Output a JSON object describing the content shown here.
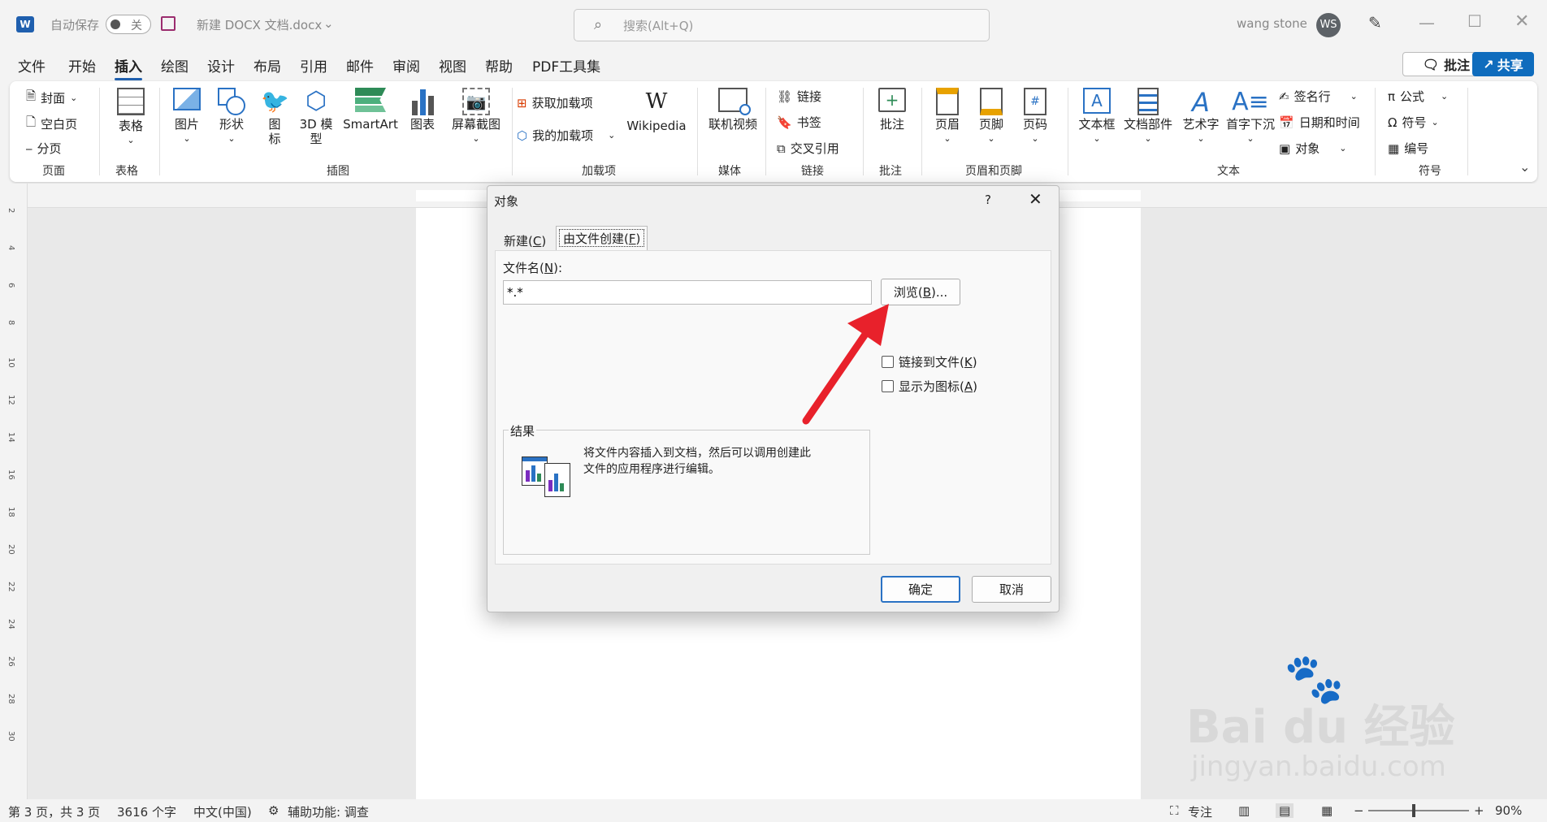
{
  "titlebar": {
    "autosave_label": "自动保存",
    "autosave_state": "关",
    "doc_title": "新建 DOCX 文档.docx",
    "search_placeholder": "搜索(Alt+Q)",
    "user_name": "wang stone",
    "user_initials": "WS"
  },
  "menu_tabs": [
    "文件",
    "开始",
    "插入",
    "绘图",
    "设计",
    "布局",
    "引用",
    "邮件",
    "审阅",
    "视图",
    "帮助",
    "PDF工具集"
  ],
  "active_tab": "插入",
  "top_right": {
    "comment": "批注",
    "share": "共享"
  },
  "ribbon": {
    "pages": {
      "cover": "封面",
      "blank": "空白页",
      "break": "分页",
      "label": "页面"
    },
    "table": {
      "btn": "表格",
      "label": "表格"
    },
    "illustrations": {
      "picture": "图片",
      "shape": "形状",
      "icon1": "图",
      "icon2": "标",
      "model1": "3D 模",
      "model2": "型",
      "smartart": "SmartArt",
      "chart": "图表",
      "screenshot": "屏幕截图",
      "label": "插图"
    },
    "addins": {
      "get": "获取加载项",
      "my": "我的加载项",
      "wiki": "Wikipedia",
      "label": "加载项"
    },
    "media": {
      "video": "联机视频",
      "label": "媒体"
    },
    "links": {
      "link": "链接",
      "bookmark": "书签",
      "crossref": "交叉引用",
      "label": "链接"
    },
    "comments": {
      "btn": "批注",
      "label": "批注"
    },
    "headerfooter": {
      "header": "页眉",
      "footer": "页脚",
      "pagenum": "页码",
      "label": "页眉和页脚"
    },
    "text": {
      "textbox": "文本框",
      "parts": "文档部件",
      "wordart": "艺术字",
      "dropcap": "首字下沉",
      "sigline": "签名行",
      "datetime": "日期和时间",
      "object": "对象",
      "label": "文本"
    },
    "symbols": {
      "equation": "公式",
      "symbol": "符号",
      "number": "编号",
      "label": "符号"
    }
  },
  "dialog": {
    "title": "对象",
    "help": "?",
    "tab_new": "新建(",
    "tab_new_key": "C",
    "tab_new_end": ")",
    "tab_file": "由文件创建(",
    "tab_file_key": "F",
    "tab_file_end": ")",
    "filename_label": "文件名(",
    "filename_key": "N",
    "filename_end": "):",
    "filename_value": "*.*",
    "browse": "浏览(",
    "browse_key": "B",
    "browse_end": ")...",
    "link_label": "链接到文件(",
    "link_key": "K",
    "link_end": ")",
    "icon_label": "显示为图标(",
    "icon_key": "A",
    "icon_end": ")",
    "result_label": "结果",
    "result_text1": "将文件内容插入到文档，然后可以调用创建此",
    "result_text2": "文件的应用程序进行编辑。",
    "ok": "确定",
    "cancel": "取消"
  },
  "statusbar": {
    "page": "第 3 页，共 3 页",
    "words": "3616 个字",
    "lang": "中文(中国)",
    "access": "辅助功能: 调查",
    "focus": "专注",
    "zoom": "90%"
  },
  "ruler_numbers": [
    "2",
    "4",
    "6",
    "8",
    "10",
    "12",
    "14",
    "16",
    "18",
    "20",
    "22",
    "24",
    "26",
    "28",
    "30"
  ],
  "watermark": {
    "brand": "Bai du 经验",
    "url": "jingyan.baidu.com"
  },
  "colors": {
    "accent": "#1f5fae",
    "share": "#0f6cbd",
    "arrow": "#e8212b"
  }
}
